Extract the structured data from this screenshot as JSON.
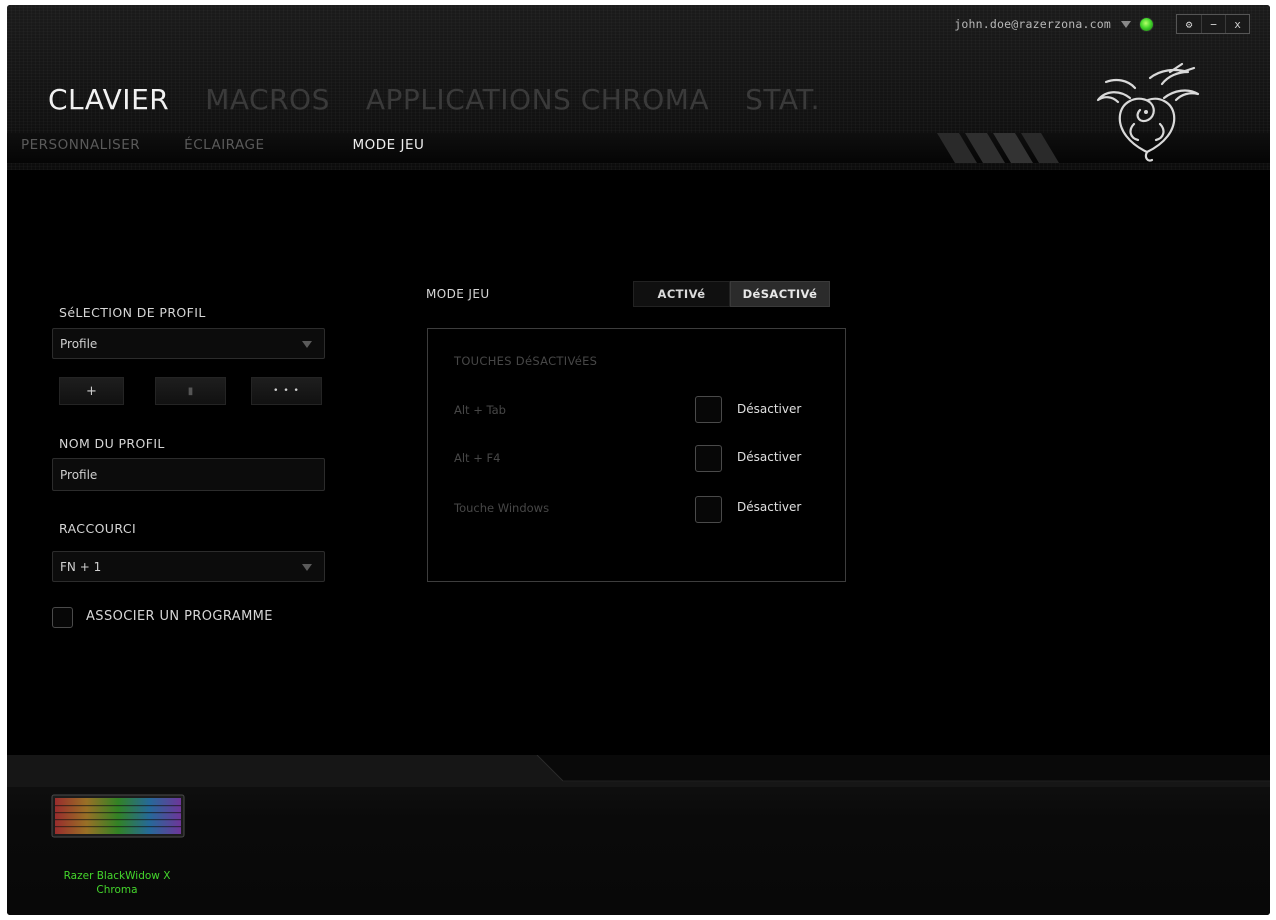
{
  "topbar": {
    "email": "john.doe@razerzona.com",
    "settings_glyph": "⚙",
    "minimize_glyph": "−",
    "close_glyph": "x"
  },
  "main_tabs": [
    "CLAVIER",
    "MACROS",
    "APPLICATIONS CHROMA",
    "STAT."
  ],
  "sub_tabs": [
    "PERSONNALISER",
    "ÉCLAIRAGE",
    "MODE JEU"
  ],
  "left_panel": {
    "profile_section_label": "SéLECTION DE PROFIL",
    "profile_select_value": "Profile",
    "add_glyph": "+",
    "delete_glyph": "▮",
    "more_glyph": "• • •",
    "profile_name_label": "NOM DU PROFIL",
    "profile_name_value": "Profile",
    "shortcut_label": "RACCOURCI",
    "shortcut_value": "FN + 1",
    "link_program_label": "ASSOCIER UN PROGRAMME"
  },
  "game_mode": {
    "label": "MODE JEU",
    "on_label": "ACTIVé",
    "off_label": "DéSACTIVé",
    "selected": "DéSACTIVé",
    "keys_title": "TOUCHES DéSACTIVéES",
    "keys": [
      {
        "name": "Alt + Tab",
        "action": "Désactiver",
        "checked": false
      },
      {
        "name": "Alt + F4",
        "action": "Désactiver",
        "checked": false
      },
      {
        "name": "Touche Windows",
        "action": "Désactiver",
        "checked": false
      }
    ]
  },
  "device": {
    "name": "Razer BlackWidow X Chroma"
  },
  "colors": {
    "accent_green": "#44d62c",
    "background": "#000000"
  },
  "icons": {
    "logo": "razer-snake-logo",
    "status": "status-dot-icon",
    "user_menu": "chevron-down-icon"
  }
}
